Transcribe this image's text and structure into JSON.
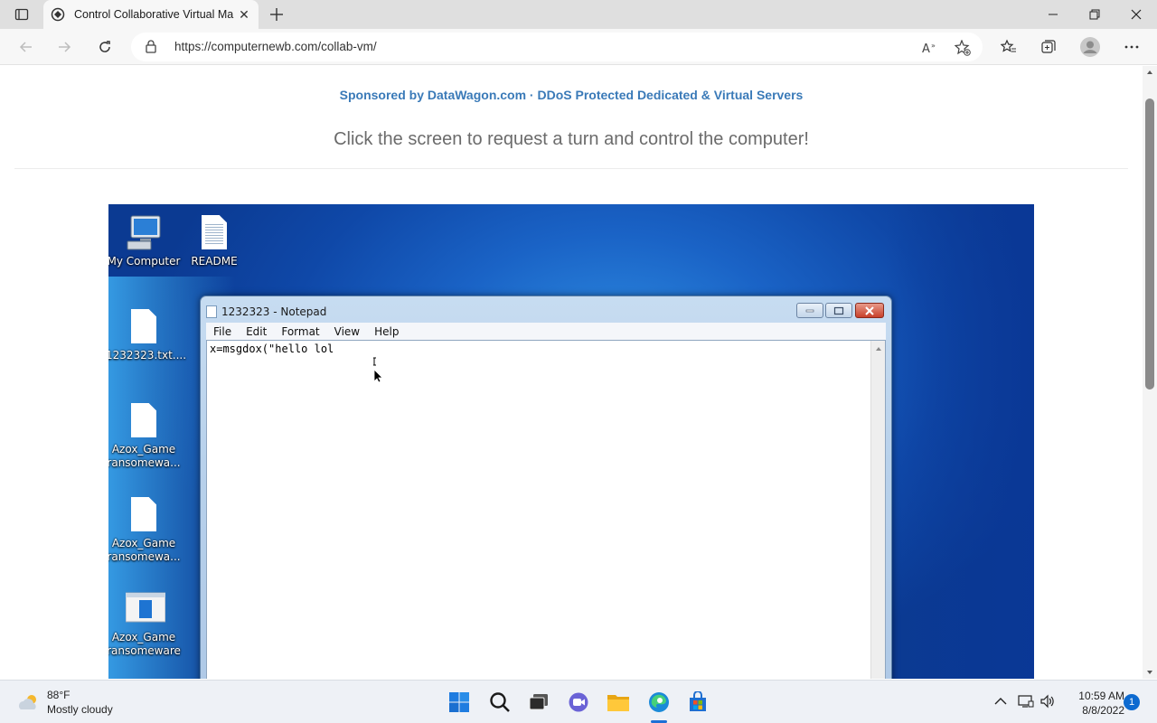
{
  "browser": {
    "tab_title": "Control Collaborative Virtual Ma",
    "url": "https://computernewb.com/collab-vm/"
  },
  "page": {
    "sponsor": "Sponsored by DataWagon.com · DDoS Protected Dedicated & Virtual Servers",
    "instructions": "Click the screen to request a turn and control the computer!"
  },
  "vm": {
    "desktop_icons": [
      {
        "label": "My Computer"
      },
      {
        "label": "README"
      },
      {
        "label": "1232323.txt...."
      },
      {
        "label": "Azox_Game ransomewa..."
      },
      {
        "label": "Azox_Game ransomewa..."
      },
      {
        "label": "Azox_Game ransomeware"
      }
    ],
    "notepad": {
      "title": "1232323 - Notepad",
      "menu": [
        "File",
        "Edit",
        "Format",
        "View",
        "Help"
      ],
      "content": "x=msgdox(\"hello lol"
    }
  },
  "taskbar": {
    "weather_temp": "88°F",
    "weather_desc": "Mostly cloudy",
    "time": "10:59 AM",
    "date": "8/8/2022",
    "notification_count": "1"
  }
}
